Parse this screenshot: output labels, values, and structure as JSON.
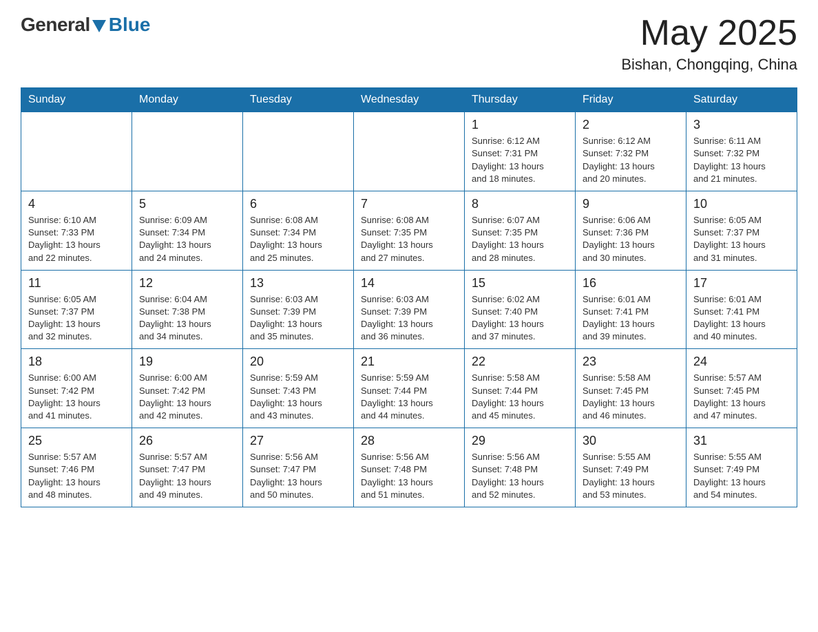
{
  "header": {
    "logo_general": "General",
    "logo_blue": "Blue",
    "month_year": "May 2025",
    "location": "Bishan, Chongqing, China"
  },
  "days_of_week": [
    "Sunday",
    "Monday",
    "Tuesday",
    "Wednesday",
    "Thursday",
    "Friday",
    "Saturday"
  ],
  "weeks": [
    [
      {
        "day": "",
        "info": ""
      },
      {
        "day": "",
        "info": ""
      },
      {
        "day": "",
        "info": ""
      },
      {
        "day": "",
        "info": ""
      },
      {
        "day": "1",
        "info": "Sunrise: 6:12 AM\nSunset: 7:31 PM\nDaylight: 13 hours\nand 18 minutes."
      },
      {
        "day": "2",
        "info": "Sunrise: 6:12 AM\nSunset: 7:32 PM\nDaylight: 13 hours\nand 20 minutes."
      },
      {
        "day": "3",
        "info": "Sunrise: 6:11 AM\nSunset: 7:32 PM\nDaylight: 13 hours\nand 21 minutes."
      }
    ],
    [
      {
        "day": "4",
        "info": "Sunrise: 6:10 AM\nSunset: 7:33 PM\nDaylight: 13 hours\nand 22 minutes."
      },
      {
        "day": "5",
        "info": "Sunrise: 6:09 AM\nSunset: 7:34 PM\nDaylight: 13 hours\nand 24 minutes."
      },
      {
        "day": "6",
        "info": "Sunrise: 6:08 AM\nSunset: 7:34 PM\nDaylight: 13 hours\nand 25 minutes."
      },
      {
        "day": "7",
        "info": "Sunrise: 6:08 AM\nSunset: 7:35 PM\nDaylight: 13 hours\nand 27 minutes."
      },
      {
        "day": "8",
        "info": "Sunrise: 6:07 AM\nSunset: 7:35 PM\nDaylight: 13 hours\nand 28 minutes."
      },
      {
        "day": "9",
        "info": "Sunrise: 6:06 AM\nSunset: 7:36 PM\nDaylight: 13 hours\nand 30 minutes."
      },
      {
        "day": "10",
        "info": "Sunrise: 6:05 AM\nSunset: 7:37 PM\nDaylight: 13 hours\nand 31 minutes."
      }
    ],
    [
      {
        "day": "11",
        "info": "Sunrise: 6:05 AM\nSunset: 7:37 PM\nDaylight: 13 hours\nand 32 minutes."
      },
      {
        "day": "12",
        "info": "Sunrise: 6:04 AM\nSunset: 7:38 PM\nDaylight: 13 hours\nand 34 minutes."
      },
      {
        "day": "13",
        "info": "Sunrise: 6:03 AM\nSunset: 7:39 PM\nDaylight: 13 hours\nand 35 minutes."
      },
      {
        "day": "14",
        "info": "Sunrise: 6:03 AM\nSunset: 7:39 PM\nDaylight: 13 hours\nand 36 minutes."
      },
      {
        "day": "15",
        "info": "Sunrise: 6:02 AM\nSunset: 7:40 PM\nDaylight: 13 hours\nand 37 minutes."
      },
      {
        "day": "16",
        "info": "Sunrise: 6:01 AM\nSunset: 7:41 PM\nDaylight: 13 hours\nand 39 minutes."
      },
      {
        "day": "17",
        "info": "Sunrise: 6:01 AM\nSunset: 7:41 PM\nDaylight: 13 hours\nand 40 minutes."
      }
    ],
    [
      {
        "day": "18",
        "info": "Sunrise: 6:00 AM\nSunset: 7:42 PM\nDaylight: 13 hours\nand 41 minutes."
      },
      {
        "day": "19",
        "info": "Sunrise: 6:00 AM\nSunset: 7:42 PM\nDaylight: 13 hours\nand 42 minutes."
      },
      {
        "day": "20",
        "info": "Sunrise: 5:59 AM\nSunset: 7:43 PM\nDaylight: 13 hours\nand 43 minutes."
      },
      {
        "day": "21",
        "info": "Sunrise: 5:59 AM\nSunset: 7:44 PM\nDaylight: 13 hours\nand 44 minutes."
      },
      {
        "day": "22",
        "info": "Sunrise: 5:58 AM\nSunset: 7:44 PM\nDaylight: 13 hours\nand 45 minutes."
      },
      {
        "day": "23",
        "info": "Sunrise: 5:58 AM\nSunset: 7:45 PM\nDaylight: 13 hours\nand 46 minutes."
      },
      {
        "day": "24",
        "info": "Sunrise: 5:57 AM\nSunset: 7:45 PM\nDaylight: 13 hours\nand 47 minutes."
      }
    ],
    [
      {
        "day": "25",
        "info": "Sunrise: 5:57 AM\nSunset: 7:46 PM\nDaylight: 13 hours\nand 48 minutes."
      },
      {
        "day": "26",
        "info": "Sunrise: 5:57 AM\nSunset: 7:47 PM\nDaylight: 13 hours\nand 49 minutes."
      },
      {
        "day": "27",
        "info": "Sunrise: 5:56 AM\nSunset: 7:47 PM\nDaylight: 13 hours\nand 50 minutes."
      },
      {
        "day": "28",
        "info": "Sunrise: 5:56 AM\nSunset: 7:48 PM\nDaylight: 13 hours\nand 51 minutes."
      },
      {
        "day": "29",
        "info": "Sunrise: 5:56 AM\nSunset: 7:48 PM\nDaylight: 13 hours\nand 52 minutes."
      },
      {
        "day": "30",
        "info": "Sunrise: 5:55 AM\nSunset: 7:49 PM\nDaylight: 13 hours\nand 53 minutes."
      },
      {
        "day": "31",
        "info": "Sunrise: 5:55 AM\nSunset: 7:49 PM\nDaylight: 13 hours\nand 54 minutes."
      }
    ]
  ]
}
